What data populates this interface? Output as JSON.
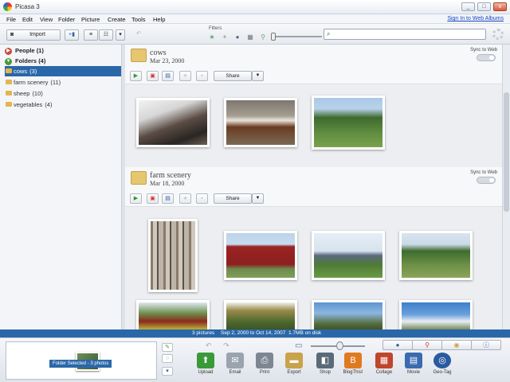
{
  "window": {
    "title": "Picasa 3",
    "minimize": "_",
    "maximize": "□",
    "close": "x"
  },
  "menu": {
    "items": [
      "File",
      "Edit",
      "View",
      "Folder",
      "Picture",
      "Create",
      "Tools",
      "Help"
    ],
    "signin": "Sign In to Web Albums"
  },
  "toolbar": {
    "import_label": "Import",
    "filters_label": "Filters",
    "search_placeholder": "",
    "search_value": ""
  },
  "sidebar": {
    "people": {
      "label": "People",
      "count": "(1)"
    },
    "folders": {
      "label": "Folders",
      "count": "(4)"
    },
    "items": [
      {
        "label": "cows",
        "count": "(3)",
        "selected": true
      },
      {
        "label": "farm scenery",
        "count": "(11)",
        "selected": false
      },
      {
        "label": "sheep",
        "count": "(10)",
        "selected": false
      },
      {
        "label": "vegetables",
        "count": "(4)",
        "selected": false
      }
    ]
  },
  "albums": [
    {
      "name": "cows",
      "date": "Mar 23, 2000",
      "sync_label": "Sync to Web",
      "share_label": "Share"
    },
    {
      "name": "farm scenery",
      "date": "Mar 18, 2000",
      "sync_label": "Sync to Web",
      "share_label": "Share"
    }
  ],
  "status": {
    "pictures": "3 pictures",
    "date_range": "Sep 2, 2000 to Oct 14, 2007",
    "disk": "1.7MB on disk"
  },
  "tray": {
    "selection_label": "Folder Selected - 3 photos",
    "actions": [
      {
        "label": "Upload",
        "icon": "upload-arrow-icon",
        "color": "#3a9a3a"
      },
      {
        "label": "Email",
        "icon": "envelope-icon",
        "color": "#9aa3ae"
      },
      {
        "label": "Print",
        "icon": "printer-icon",
        "color": "#7d8794"
      },
      {
        "label": "Export",
        "icon": "export-folder-icon",
        "color": "#c9a24a"
      },
      {
        "label": "Shop",
        "icon": "shop-bag-icon",
        "color": "#5a6a7a"
      },
      {
        "label": "BlogThis!",
        "icon": "blogger-icon",
        "color": "#e07a20"
      },
      {
        "label": "Collage",
        "icon": "collage-icon",
        "color": "#c0452a"
      },
      {
        "label": "Movie",
        "icon": "movie-film-icon",
        "color": "#3a6ab0"
      },
      {
        "label": "Geo-Tag",
        "icon": "globe-icon",
        "color": "#2a5aa0"
      }
    ]
  },
  "colors": {
    "selection": "#2a67a9",
    "statusbar": "#2a67a9",
    "folder": "#e6c66f"
  }
}
